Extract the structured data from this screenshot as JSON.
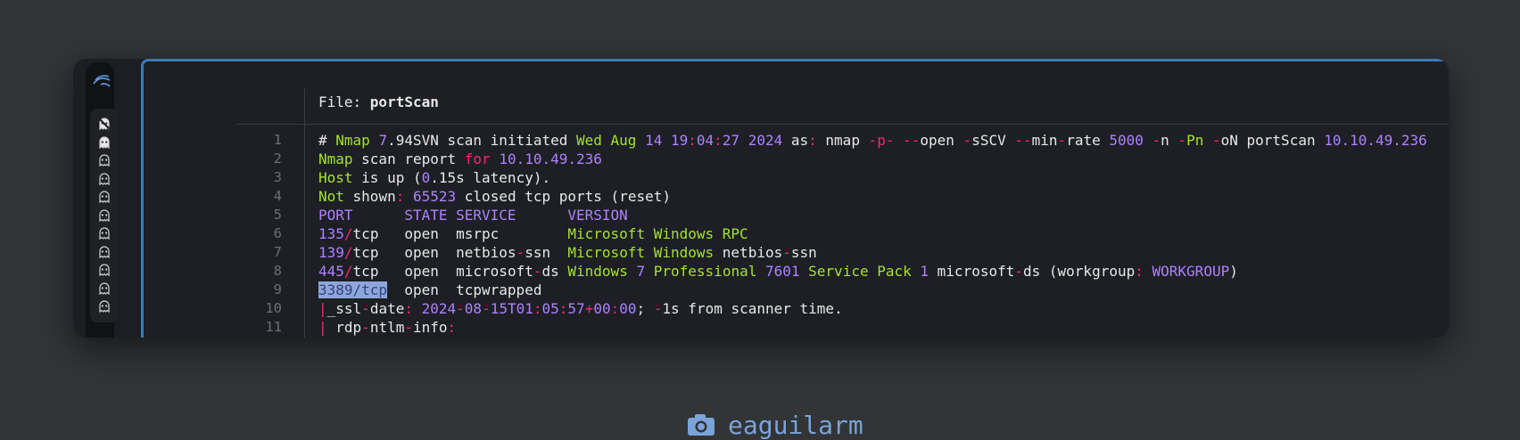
{
  "file": {
    "label": "File: ",
    "name": "portScan"
  },
  "line_numbers": [
    "1",
    "2",
    "3",
    "4",
    "5",
    "6",
    "7",
    "8",
    "9",
    "10",
    "11"
  ],
  "lines": [
    [
      {
        "t": "# ",
        "c": ""
      },
      {
        "t": "Nmap",
        "c": "g"
      },
      {
        "t": " ",
        "c": ""
      },
      {
        "t": "7",
        "c": "p"
      },
      {
        "t": ".94SVN scan initiated ",
        "c": ""
      },
      {
        "t": "Wed Aug",
        "c": "g"
      },
      {
        "t": " ",
        "c": ""
      },
      {
        "t": "14 19",
        "c": "p"
      },
      {
        "t": ":",
        "c": "r"
      },
      {
        "t": "04",
        "c": "p"
      },
      {
        "t": ":",
        "c": "r"
      },
      {
        "t": "27 2024",
        "c": "p"
      },
      {
        "t": " as",
        "c": ""
      },
      {
        "t": ":",
        "c": "r"
      },
      {
        "t": " nmap ",
        "c": ""
      },
      {
        "t": "-p-",
        "c": "r"
      },
      {
        "t": " ",
        "c": ""
      },
      {
        "t": "--",
        "c": "r"
      },
      {
        "t": "open ",
        "c": ""
      },
      {
        "t": "-",
        "c": "r"
      },
      {
        "t": "sSCV ",
        "c": ""
      },
      {
        "t": "--",
        "c": "r"
      },
      {
        "t": "min",
        "c": ""
      },
      {
        "t": "-",
        "c": "r"
      },
      {
        "t": "rate ",
        "c": ""
      },
      {
        "t": "5000",
        "c": "p"
      },
      {
        "t": " ",
        "c": ""
      },
      {
        "t": "-",
        "c": "r"
      },
      {
        "t": "n ",
        "c": ""
      },
      {
        "t": "-",
        "c": "r"
      },
      {
        "t": "Pn",
        "c": "g"
      },
      {
        "t": " ",
        "c": ""
      },
      {
        "t": "-",
        "c": "r"
      },
      {
        "t": "oN portScan ",
        "c": ""
      },
      {
        "t": "10.10.49.236",
        "c": "p"
      }
    ],
    [
      {
        "t": "Nmap",
        "c": "g"
      },
      {
        "t": " scan report ",
        "c": ""
      },
      {
        "t": "for",
        "c": "r"
      },
      {
        "t": " ",
        "c": ""
      },
      {
        "t": "10.10.49.236",
        "c": "p"
      }
    ],
    [
      {
        "t": "Host",
        "c": "g"
      },
      {
        "t": " is up (",
        "c": ""
      },
      {
        "t": "0",
        "c": "p"
      },
      {
        "t": ".15s latency).",
        "c": ""
      }
    ],
    [
      {
        "t": "Not",
        "c": "g"
      },
      {
        "t": " shown",
        "c": ""
      },
      {
        "t": ":",
        "c": "r"
      },
      {
        "t": " ",
        "c": ""
      },
      {
        "t": "65523",
        "c": "p"
      },
      {
        "t": " closed tcp ports (reset)",
        "c": ""
      }
    ],
    [
      {
        "t": "PORT      STATE SERVICE      VERSION",
        "c": "p"
      }
    ],
    [
      {
        "t": "135",
        "c": "p"
      },
      {
        "t": "/",
        "c": "r"
      },
      {
        "t": "tcp   open  msrpc        ",
        "c": ""
      },
      {
        "t": "Microsoft Windows RPC",
        "c": "g"
      }
    ],
    [
      {
        "t": "139",
        "c": "p"
      },
      {
        "t": "/",
        "c": "r"
      },
      {
        "t": "tcp   open  netbios",
        "c": ""
      },
      {
        "t": "-",
        "c": "r"
      },
      {
        "t": "ssn  ",
        "c": ""
      },
      {
        "t": "Microsoft Windows",
        "c": "g"
      },
      {
        "t": " netbios",
        "c": ""
      },
      {
        "t": "-",
        "c": "r"
      },
      {
        "t": "ssn",
        "c": ""
      }
    ],
    [
      {
        "t": "445",
        "c": "p"
      },
      {
        "t": "/",
        "c": "r"
      },
      {
        "t": "tcp   open  microsoft",
        "c": ""
      },
      {
        "t": "-",
        "c": "r"
      },
      {
        "t": "ds ",
        "c": ""
      },
      {
        "t": "Windows",
        "c": "g"
      },
      {
        "t": " ",
        "c": ""
      },
      {
        "t": "7",
        "c": "p"
      },
      {
        "t": " ",
        "c": ""
      },
      {
        "t": "Professional",
        "c": "g"
      },
      {
        "t": " ",
        "c": ""
      },
      {
        "t": "7601",
        "c": "p"
      },
      {
        "t": " ",
        "c": ""
      },
      {
        "t": "Service Pack",
        "c": "g"
      },
      {
        "t": " ",
        "c": ""
      },
      {
        "t": "1",
        "c": "p"
      },
      {
        "t": " microsoft",
        "c": ""
      },
      {
        "t": "-",
        "c": "r"
      },
      {
        "t": "ds (workgroup",
        "c": ""
      },
      {
        "t": ":",
        "c": "r"
      },
      {
        "t": " ",
        "c": ""
      },
      {
        "t": "WORKGROUP",
        "c": "p"
      },
      {
        "t": ")",
        "c": ""
      }
    ],
    [
      {
        "t": "3389/tcp",
        "c": "sel"
      },
      {
        "t": "  open  tcpwrapped",
        "c": ""
      }
    ],
    [
      {
        "t": "|",
        "c": "r"
      },
      {
        "t": "_ssl",
        "c": ""
      },
      {
        "t": "-",
        "c": "r"
      },
      {
        "t": "date",
        "c": ""
      },
      {
        "t": ":",
        "c": "r"
      },
      {
        "t": " ",
        "c": ""
      },
      {
        "t": "2024",
        "c": "p"
      },
      {
        "t": "-",
        "c": "r"
      },
      {
        "t": "08",
        "c": "p"
      },
      {
        "t": "-",
        "c": "r"
      },
      {
        "t": "15T01",
        "c": "p"
      },
      {
        "t": ":",
        "c": "r"
      },
      {
        "t": "05",
        "c": "p"
      },
      {
        "t": ":",
        "c": "r"
      },
      {
        "t": "57",
        "c": "p"
      },
      {
        "t": "+",
        "c": "r"
      },
      {
        "t": "00",
        "c": "p"
      },
      {
        "t": ":",
        "c": "r"
      },
      {
        "t": "00",
        "c": "p"
      },
      {
        "t": "; ",
        "c": ""
      },
      {
        "t": "-",
        "c": "r"
      },
      {
        "t": "1s from scanner time.",
        "c": ""
      }
    ],
    [
      {
        "t": "|",
        "c": "r"
      },
      {
        "t": " rdp",
        "c": ""
      },
      {
        "t": "-",
        "c": "r"
      },
      {
        "t": "ntlm",
        "c": ""
      },
      {
        "t": "-",
        "c": "r"
      },
      {
        "t": "info",
        "c": ""
      },
      {
        "t": ":",
        "c": "r"
      }
    ]
  ],
  "caption": {
    "icon": "camera-icon",
    "text": "eaguilarm"
  },
  "colors": {
    "green": "#a6e22e",
    "purple": "#ae81ff",
    "pink": "#f92672",
    "accent": "#3d7ab8"
  },
  "workspaces": [
    "ghost-icon-active",
    "ghost-icon",
    "ghost-icon",
    "ghost-icon",
    "ghost-icon",
    "ghost-icon",
    "ghost-icon",
    "ghost-icon",
    "ghost-icon",
    "ghost-icon",
    "ghost-icon"
  ]
}
